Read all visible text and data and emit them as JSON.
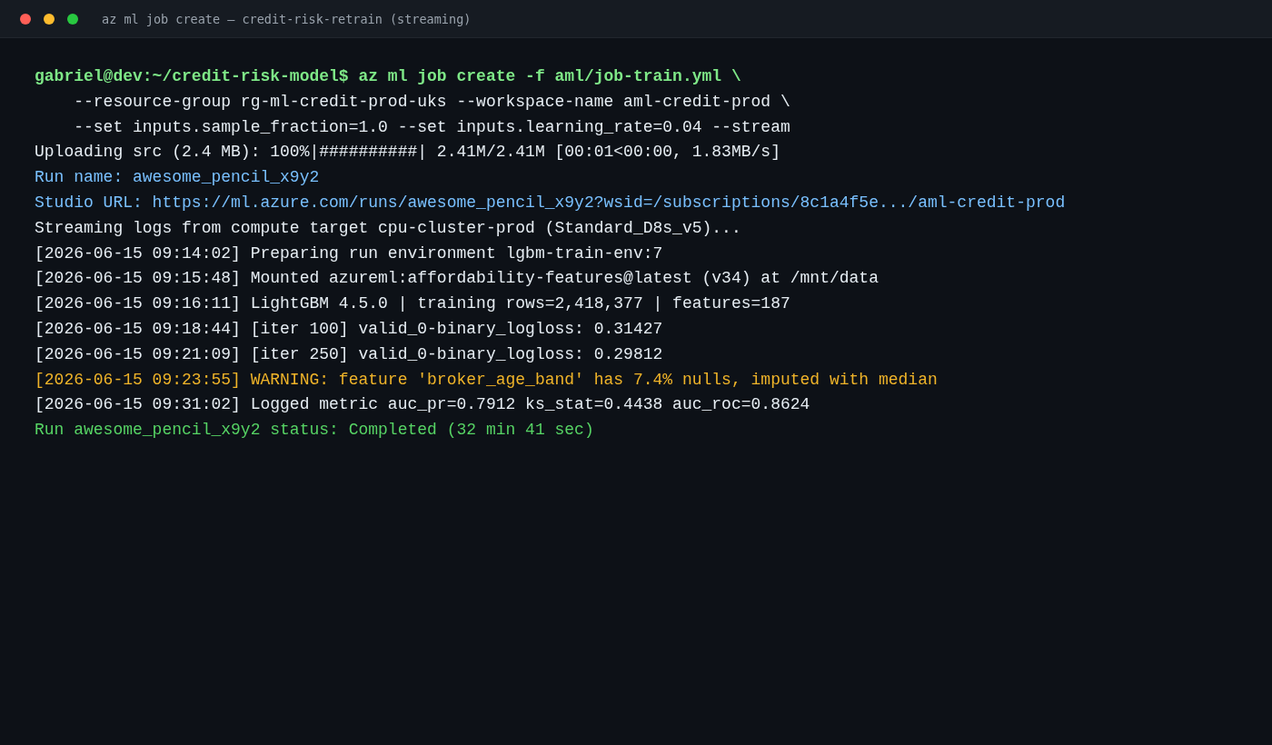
{
  "window": {
    "title": "az ml job create — credit-risk-retrain (streaming)"
  },
  "terminal": {
    "lines": [
      {
        "kind": "command",
        "text": "gabriel@dev:~/credit-risk-model$ az ml job create -f aml/job-train.yml \\"
      },
      {
        "kind": "plain",
        "text": "    --resource-group rg-ml-credit-prod-uks --workspace-name aml-credit-prod \\"
      },
      {
        "kind": "plain",
        "text": "    --set inputs.sample_fraction=1.0 --set inputs.learning_rate=0.04 --stream"
      },
      {
        "kind": "plain",
        "text": "Uploading src (2.4 MB): 100%|##########| 2.41M/2.41M [00:01<00:00, 1.83MB/s]"
      },
      {
        "kind": "info",
        "text": "Run name: awesome_pencil_x9y2"
      },
      {
        "kind": "info",
        "text": "Studio URL: https://ml.azure.com/runs/awesome_pencil_x9y2?wsid=/subscriptions/8c1a4f5e.../aml-credit-prod"
      },
      {
        "kind": "plain",
        "text": "Streaming logs from compute target cpu-cluster-prod (Standard_D8s_v5)..."
      },
      {
        "kind": "plain",
        "text": "[2026-06-15 09:14:02] Preparing run environment lgbm-train-env:7"
      },
      {
        "kind": "plain",
        "text": "[2026-06-15 09:15:48] Mounted azureml:affordability-features@latest (v34) at /mnt/data"
      },
      {
        "kind": "plain",
        "text": "[2026-06-15 09:16:11] LightGBM 4.5.0 | training rows=2,418,377 | features=187"
      },
      {
        "kind": "plain",
        "text": "[2026-06-15 09:18:44] [iter 100] valid_0-binary_logloss: 0.31427"
      },
      {
        "kind": "plain",
        "text": "[2026-06-15 09:21:09] [iter 250] valid_0-binary_logloss: 0.29812"
      },
      {
        "kind": "warning",
        "text": "[2026-06-15 09:23:55] WARNING: feature 'broker_age_band' has 7.4% nulls, imputed with median"
      },
      {
        "kind": "plain",
        "text": "[2026-06-15 09:31:02] Logged metric auc_pr=0.7912 ks_stat=0.4438 auc_roc=0.8624"
      },
      {
        "kind": "success",
        "text": "Run awesome_pencil_x9y2 status: Completed (32 min 41 sec)"
      }
    ]
  }
}
